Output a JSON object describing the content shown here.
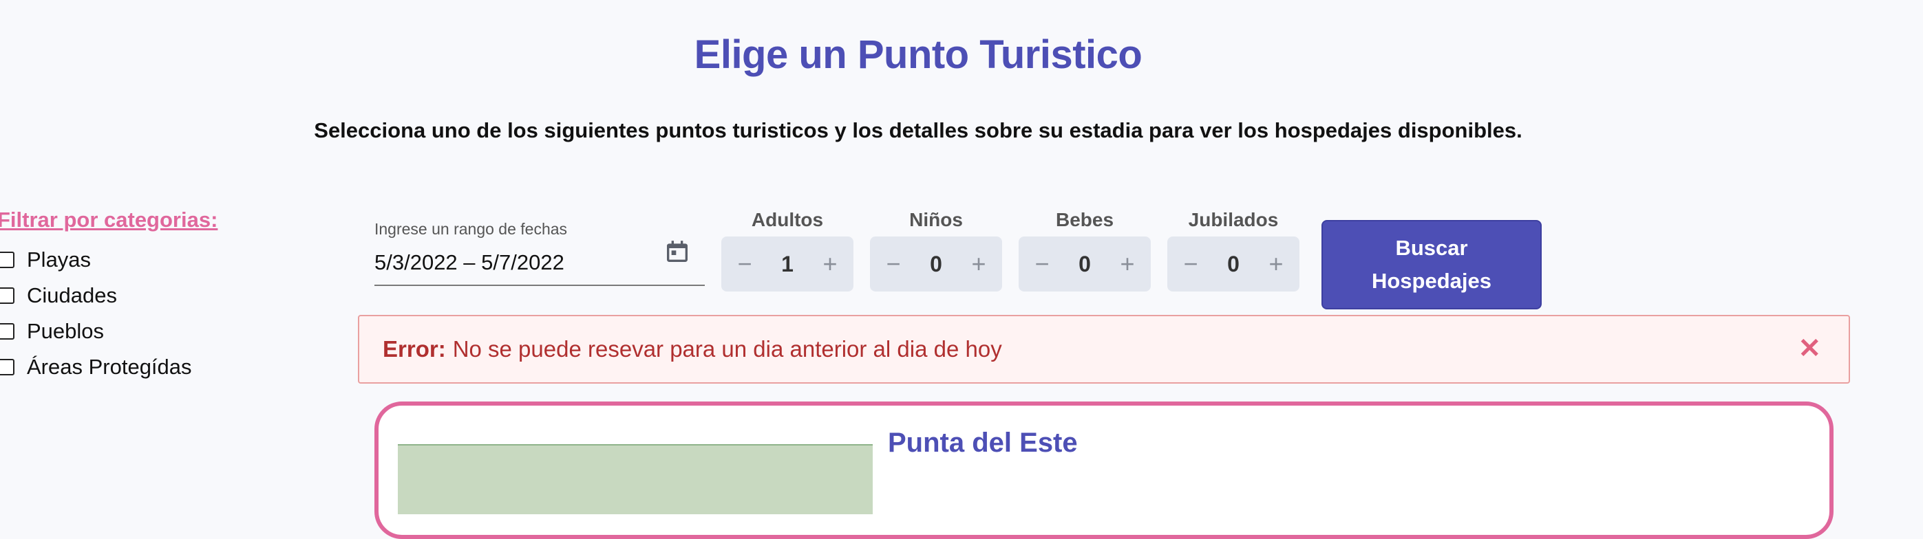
{
  "page": {
    "title": "Elige un Punto Turistico",
    "subtitle": "Selecciona uno de los siguientes puntos turisticos y los detalles sobre su estadia para ver los hospedajes disponibles."
  },
  "filters": {
    "title": "Filtrar por categorias:",
    "items": [
      {
        "label": "Playas",
        "checked": false
      },
      {
        "label": "Ciudades",
        "checked": false
      },
      {
        "label": "Pueblos",
        "checked": false
      },
      {
        "label": "Áreas Protegídas",
        "checked": false
      }
    ]
  },
  "date_range": {
    "label": "Ingrese un rango de fechas",
    "value": "5/3/2022 – 5/7/2022",
    "icon": "calendar-icon"
  },
  "counters": [
    {
      "label": "Adultos",
      "value": "1",
      "minus": "−",
      "plus": "+"
    },
    {
      "label": "Niños",
      "value": "0",
      "minus": "−",
      "plus": "+"
    },
    {
      "label": "Bebes",
      "value": "0",
      "minus": "−",
      "plus": "+"
    },
    {
      "label": "Jubilados",
      "value": "0",
      "minus": "−",
      "plus": "+"
    }
  ],
  "search_button": {
    "line1": "Buscar",
    "line2": "Hospedajes"
  },
  "alert": {
    "strong": "Error:",
    "message": "No se puede resevar para un dia anterior al dia de hoy",
    "close": "✕"
  },
  "card": {
    "title": "Punta del Este"
  },
  "colors": {
    "primary": "#4d4fb5",
    "accent": "#e0679c",
    "error_text": "#b02f2f",
    "error_bg": "#fff3f3"
  }
}
